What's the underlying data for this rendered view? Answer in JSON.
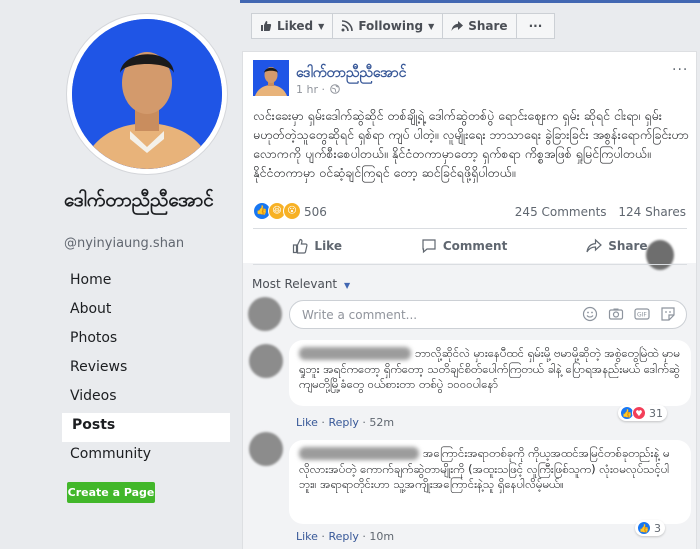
{
  "page": {
    "name": "ဒေါက်တာညီညီအောင်",
    "handle": "@nyinyiaung.shan"
  },
  "nav": {
    "items": [
      {
        "label": "Home"
      },
      {
        "label": "About"
      },
      {
        "label": "Photos"
      },
      {
        "label": "Reviews"
      },
      {
        "label": "Videos"
      },
      {
        "label": "Posts"
      },
      {
        "label": "Community"
      }
    ],
    "active": "Posts",
    "create_page_label": "Create a Page"
  },
  "actionbar": {
    "liked_label": "Liked",
    "following_label": "Following",
    "share_label": "Share",
    "more_label": "···"
  },
  "post": {
    "author": "ဒေါက်တာညီညီအောင်",
    "time": "1 hr ·",
    "more": "···",
    "text": "လင်းခေးမှာ ရှမ်းဒေါက်ဆွဲဆိုင် တစ်ချို့ရဲ့ ဒေါက်ဆွဲတစ်ပွဲ ရောင်းဈေးက ရှမ်း ဆိုရင် ငါးရာ၊ ရှမ်းမဟုတ်တဲ့သူတွေဆိုရင် ရှစ်ရာ ကျပ် ပါတဲ့။ လူမျိုးရေး ဘာသာရေး ခွဲခြားခြင်း အစွန်းရောက်ခြင်းဟာ လောကကို ပျက်စီးစေပါတယ်။ နိုင်ငံတကာမှာတော့ ရှက်စရာ ကိစ္စအဖြစ် ရှုမြင်ကြပါတယ်။ နိုင်ငံတကာမှာ ဝင်ဆံ့ချင်ကြရင် တော့ ဆင်ခြင်ရဖို့ရှိပါတယ်။",
    "reaction_count": "506",
    "comments_count": "245 Comments",
    "shares_count": "124 Shares",
    "actions": {
      "like": "Like",
      "comment": "Comment",
      "share": "Share"
    }
  },
  "comments_section": {
    "sort_label": "Most Relevant",
    "write_placeholder": "Write a comment...",
    "comments": [
      {
        "text": "ဘာလို့ဆိုင်လဲ မှားနေပီထင် ရှမ်းမို့ ဗမာမို့ဆိုတဲ့ အစွဲတွေမြဲထဲ မှာမရှုဘူး အရင်ကတော့ ရှိက်တော့ သတိချင်စိတ်ပေါက်ကြတယ် ခါနဲ့ ပြောရအနည်းမယ် ဒေါက်ဆွဲကျမတို့မြို့ခံတွေ ဝယ်စားတာ တစ်ပွဲ ၁၀၀၀ပါနော်",
        "like": "Like",
        "reply": "Reply",
        "time": "52m",
        "reactions": "31"
      },
      {
        "text": "အကြောင်းအရာတစ်ခုကို ကိုယ့အထင်အမြင်တစ်ခုတည်းနဲ့ မလိုလားအပ်တဲ့ ကောက်ချက်ဆွဲတာမျိုးကို (အထူးသဖြင့် လူကြီးဖြစ်သူက) လုံးဝမလုပ်သင့်ပါဘူး။ အရာရာတိုင်းဟာ သူ့အကျိုးအကြောင်းနဲ့သူ ရှိနေပါလိမ့်မယ်။",
        "like": "Like",
        "reply": "Reply",
        "time": "10m",
        "reactions": "3"
      }
    ]
  },
  "colors": {
    "brand": "#4267b2",
    "link": "#385898",
    "create_button": "#42b72a",
    "avatar_bg": "#1f55e6"
  }
}
